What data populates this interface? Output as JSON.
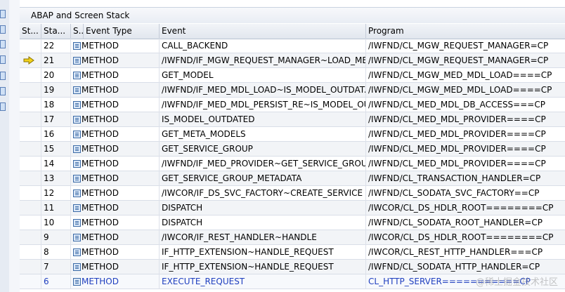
{
  "panel": {
    "title": "ABAP and Screen Stack"
  },
  "table": {
    "columns": {
      "sign": "St...",
      "level": "Sta...",
      "s": "S...",
      "type": "Event Type",
      "event": "Event",
      "program": "Program"
    },
    "rows": [
      {
        "level": "22",
        "type": "METHOD",
        "event": "CALL_BACKEND",
        "program": "/IWFND/CL_MGW_REQUEST_MANAGER=CP",
        "current": false
      },
      {
        "level": "21",
        "type": "METHOD",
        "event": "/IWFND/IF_MGW_REQUEST_MANAGER~LOAD_ME...",
        "program": "/IWFND/CL_MGW_REQUEST_MANAGER=CP",
        "current": true
      },
      {
        "level": "20",
        "type": "METHOD",
        "event": "GET_MODEL",
        "program": "/IWFND/CL_MGW_MED_MDL_LOAD====CP",
        "current": false
      },
      {
        "level": "19",
        "type": "METHOD",
        "event": "/IWFND/IF_MED_MDL_LOAD~IS_MODEL_OUTDAT...",
        "program": "/IWFND/CL_MGW_MED_MDL_LOAD====CP",
        "current": false
      },
      {
        "level": "18",
        "type": "METHOD",
        "event": "/IWFND/IF_MED_MDL_PERSIST_RE~IS_MODEL_OU...",
        "program": "/IWFND/CL_MED_MDL_DB_ACCESS===CP",
        "current": false
      },
      {
        "level": "17",
        "type": "METHOD",
        "event": "IS_MODEL_OUTDATED",
        "program": "/IWFND/CL_MED_MDL_PROVIDER====CP",
        "current": false
      },
      {
        "level": "16",
        "type": "METHOD",
        "event": "GET_META_MODELS",
        "program": "/IWFND/CL_MED_MDL_PROVIDER====CP",
        "current": false
      },
      {
        "level": "15",
        "type": "METHOD",
        "event": "GET_SERVICE_GROUP",
        "program": "/IWFND/CL_MED_MDL_PROVIDER====CP",
        "current": false
      },
      {
        "level": "14",
        "type": "METHOD",
        "event": "/IWFND/IF_MED_PROVIDER~GET_SERVICE_GROUP",
        "program": "/IWFND/CL_MED_MDL_PROVIDER====CP",
        "current": false
      },
      {
        "level": "13",
        "type": "METHOD",
        "event": "GET_SERVICE_GROUP_METADATA",
        "program": "/IWFND/CL_TRANSACTION_HANDLER=CP",
        "current": false
      },
      {
        "level": "12",
        "type": "METHOD",
        "event": "/IWCOR/IF_DS_SVC_FACTORY~CREATE_SERVICE",
        "program": "/IWFND/CL_SODATA_SVC_FACTORY==CP",
        "current": false
      },
      {
        "level": "11",
        "type": "METHOD",
        "event": "DISPATCH",
        "program": "/IWCOR/CL_DS_HDLR_ROOT========CP",
        "current": false
      },
      {
        "level": "10",
        "type": "METHOD",
        "event": "DISPATCH",
        "program": "/IWFND/CL_SODATA_ROOT_HANDLER=CP",
        "current": false
      },
      {
        "level": "9",
        "type": "METHOD",
        "event": "/IWCOR/IF_REST_HANDLER~HANDLE",
        "program": "/IWCOR/CL_DS_HDLR_ROOT========CP",
        "current": false
      },
      {
        "level": "8",
        "type": "METHOD",
        "event": "IF_HTTP_EXTENSION~HANDLE_REQUEST",
        "program": "/IWCOR/CL_REST_HTTP_HANDLER===CP",
        "current": false
      },
      {
        "level": "7",
        "type": "METHOD",
        "event": "IF_HTTP_EXTENSION~HANDLE_REQUEST",
        "program": "/IWFND/CL_SODATA_HTTP_HANDLER=CP",
        "current": false
      },
      {
        "level": "6",
        "type": "METHOD",
        "event": "EXECUTE_REQUEST",
        "program": "CL_HTTP_SERVER===========CP",
        "current": false
      }
    ]
  },
  "watermark": "@稀土掘金技术社区",
  "colors": {
    "last_row_text": "#1f3fbf",
    "arrow": "#f2d21b"
  }
}
